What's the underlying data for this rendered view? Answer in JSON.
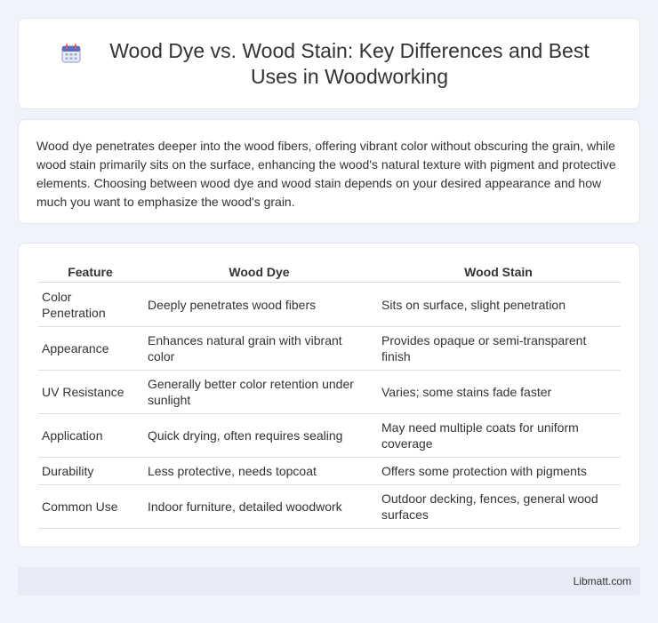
{
  "header": {
    "icon": "calendar-icon",
    "title": "Wood Dye vs. Wood Stain: Key Differences and Best Uses in Woodworking"
  },
  "intro": {
    "text": "Wood dye penetrates deeper into the wood fibers, offering vibrant color without obscuring the grain, while wood stain primarily sits on the surface, enhancing the wood's natural texture with pigment and protective elements. Choosing between wood dye and wood stain depends on your desired appearance and how much you want to emphasize the wood's grain."
  },
  "table": {
    "headers": [
      "Feature",
      "Wood Dye",
      "Wood Stain"
    ],
    "rows": [
      [
        "Color Penetration",
        "Deeply penetrates wood fibers",
        "Sits on surface, slight penetration"
      ],
      [
        "Appearance",
        "Enhances natural grain with vibrant color",
        "Provides opaque or semi-transparent finish"
      ],
      [
        "UV Resistance",
        "Generally better color retention under sunlight",
        "Varies; some stains fade faster"
      ],
      [
        "Application",
        "Quick drying, often requires sealing",
        "May need multiple coats for uniform coverage"
      ],
      [
        "Durability",
        "Less protective, needs topcoat",
        "Offers some protection with pigments"
      ],
      [
        "Common Use",
        "Indoor furniture, detailed woodwork",
        "Outdoor decking, fences, general wood surfaces"
      ]
    ]
  },
  "footer": {
    "brand": "Libmatt.com"
  }
}
